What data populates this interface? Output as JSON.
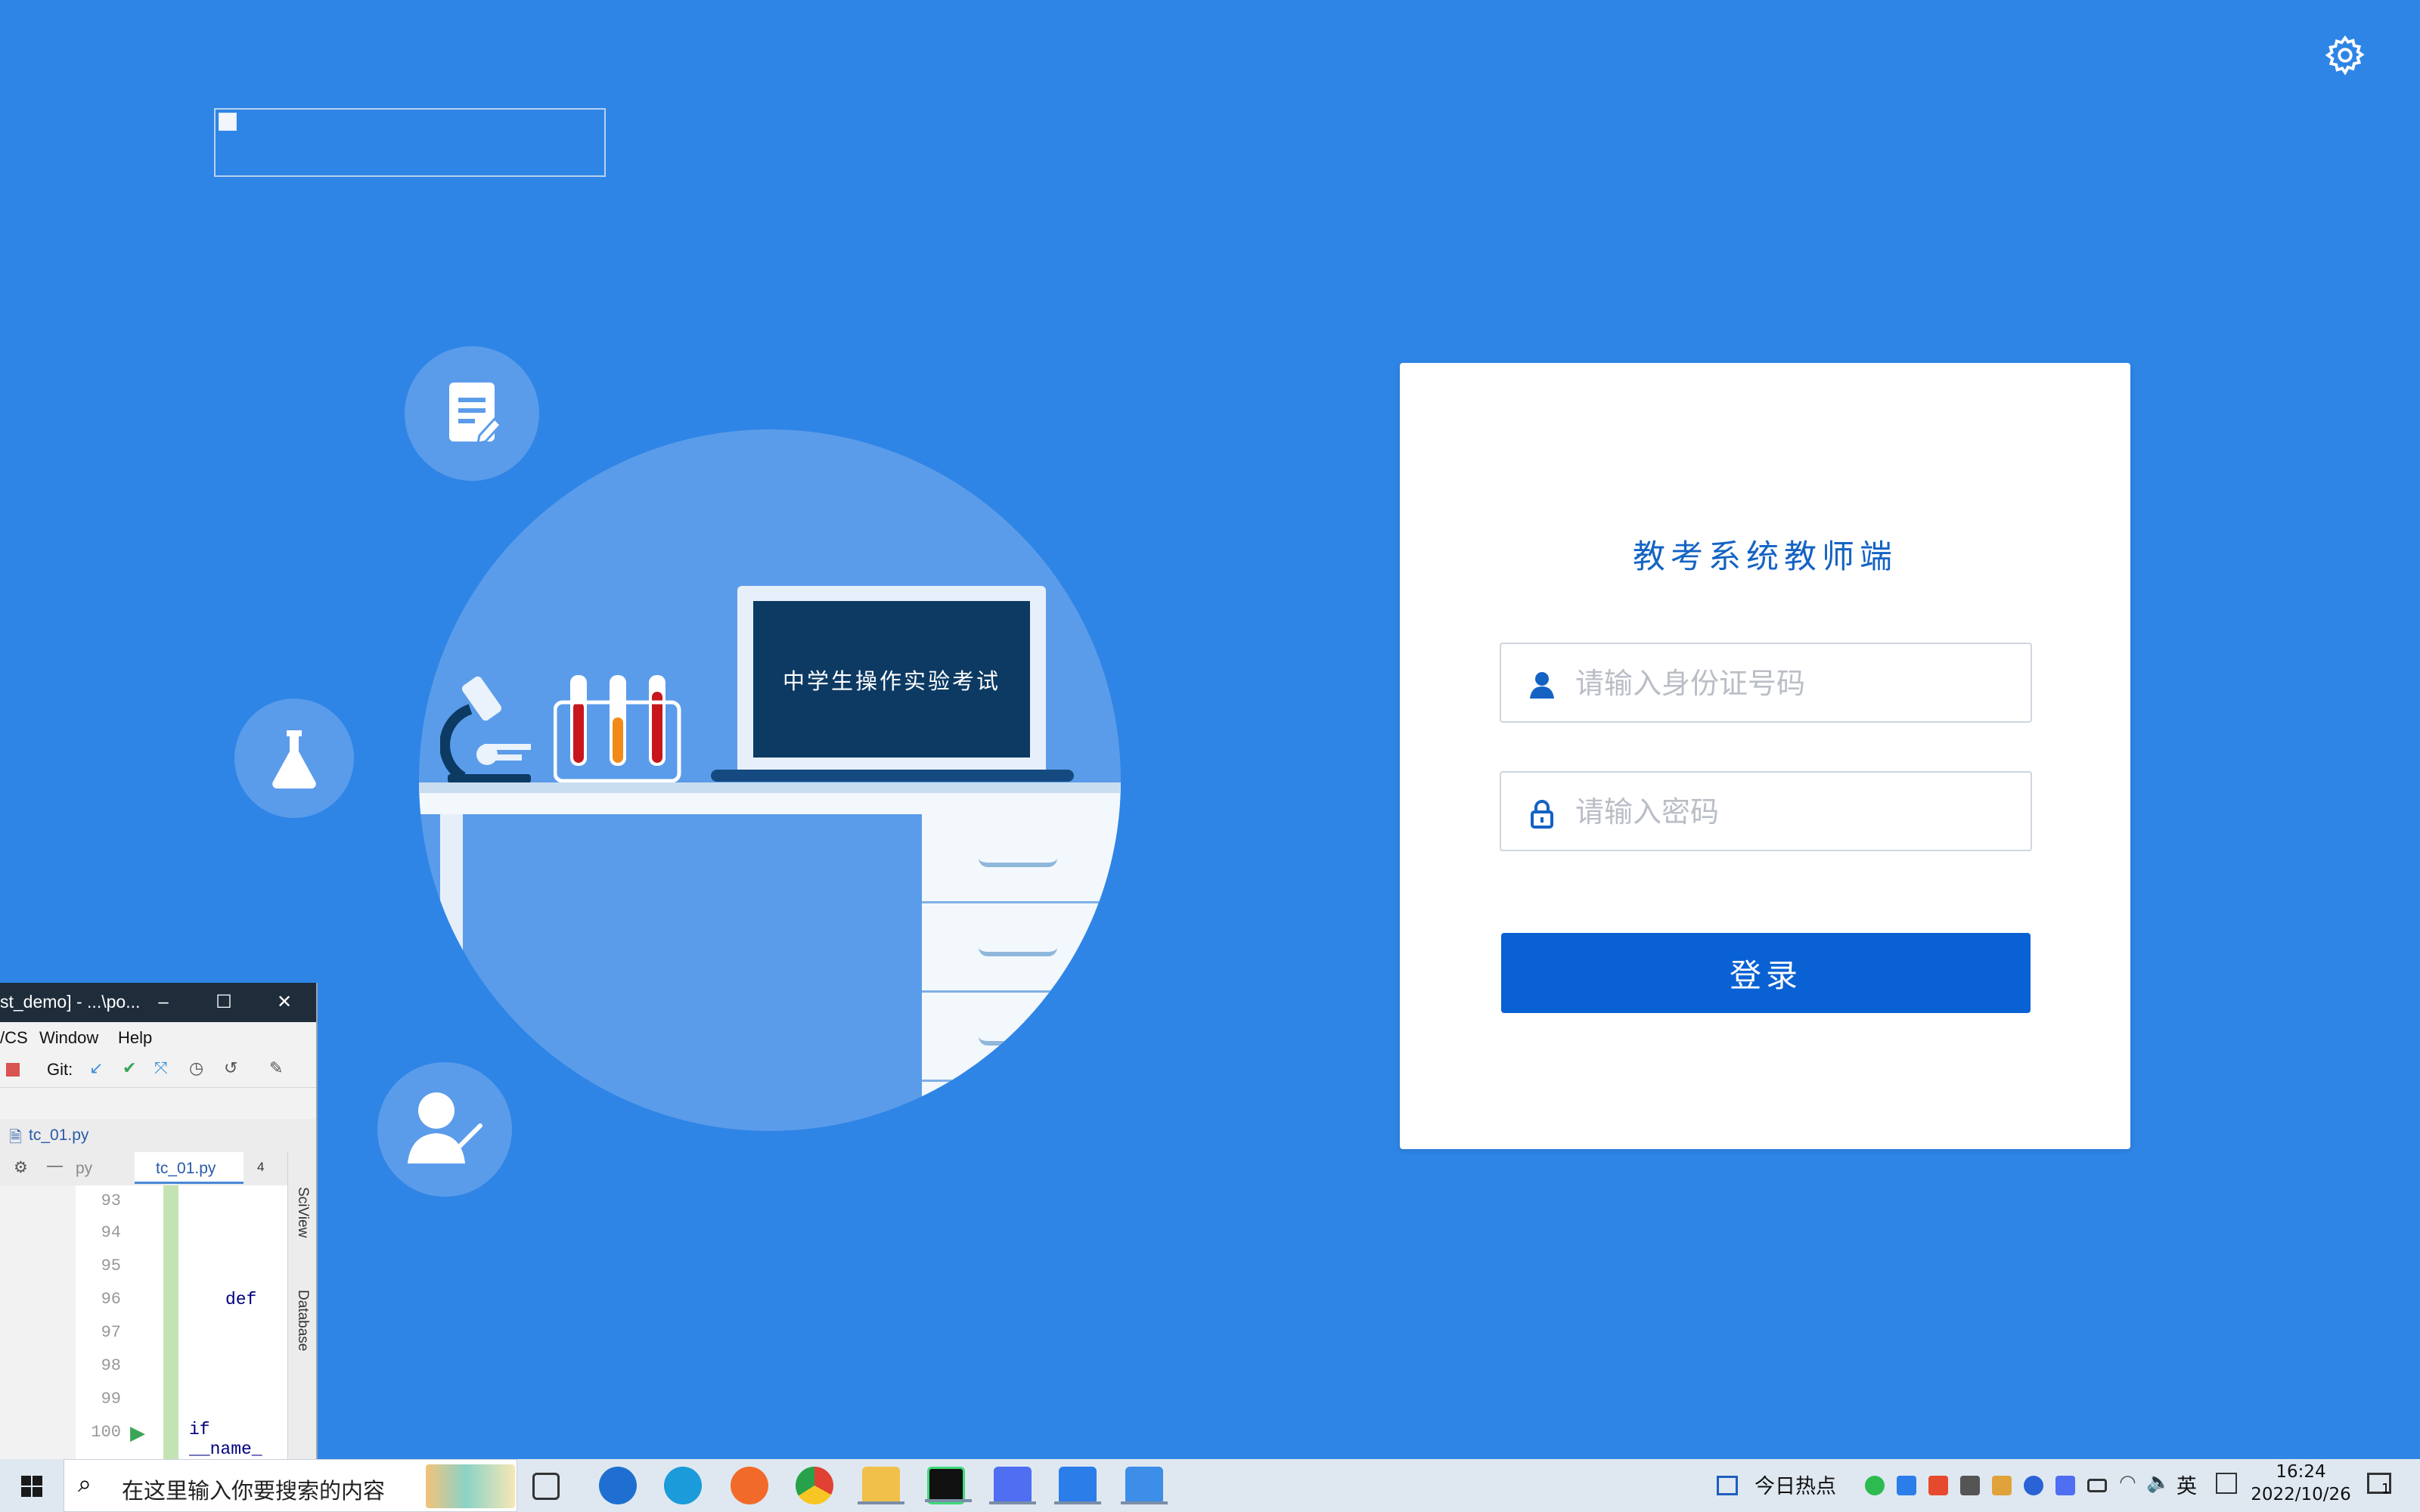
{
  "login": {
    "title": "教考系统教师端",
    "id_placeholder": "请输入身份证号码",
    "password_placeholder": "请输入密码",
    "login_button": "登录"
  },
  "illustration": {
    "screen_text": "中学生操作实验考试"
  },
  "ide": {
    "title": "st_demo] - ...\\po...",
    "menu": [
      "/CS",
      "Window",
      "Help"
    ],
    "git_label": "Git:",
    "breadcrumb": "tc_01.py",
    "tabs": [
      "py",
      "tc_01.py"
    ],
    "tab_count": "4",
    "line_numbers": [
      "93",
      "94",
      "95",
      "96",
      "97",
      "98",
      "99",
      "100"
    ],
    "code": {
      "def_line": "def",
      "if_line": "if __name_"
    },
    "side_labels": [
      "SciView",
      "Database"
    ]
  },
  "taskbar": {
    "search_placeholder": "在这里输入你要搜索的内容",
    "news": "今日热点",
    "ime": "英",
    "time": "16:24",
    "date": "2022/10/26",
    "notification_count": "1",
    "apps": [
      "task-view-icon",
      "ie-icon",
      "edge-icon",
      "firefox-icon",
      "chrome-icon",
      "file-explorer-icon",
      "pycharm-icon",
      "feishu-doc-icon",
      "feishu-icon",
      "classroom-icon"
    ]
  },
  "colors": {
    "background": "#2e85e6",
    "primary_button": "#0a61d4",
    "title": "#1463c3"
  }
}
